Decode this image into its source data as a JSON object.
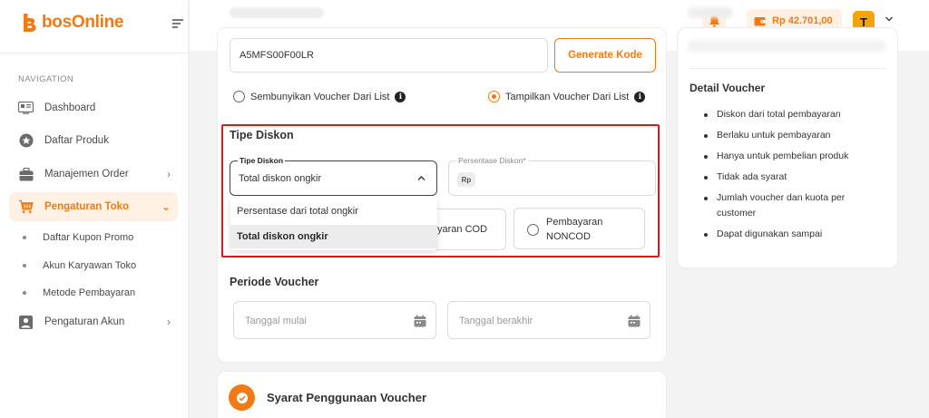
{
  "brand": {
    "name": "bosOnline",
    "accent": "#f07a16"
  },
  "sidebar": {
    "section_title": "NAVIGATION",
    "items": [
      {
        "label": "Dashboard",
        "icon": "dashboard-icon"
      },
      {
        "label": "Daftar Produk",
        "icon": "star-badge-icon"
      },
      {
        "label": "Manajemen Order",
        "icon": "briefcase-icon"
      },
      {
        "label": "Pengaturan Toko",
        "icon": "cart-icon",
        "active": true
      },
      {
        "label": "Pengaturan Akun",
        "icon": "user-icon"
      }
    ],
    "sub_items": [
      "Daftar Kupon Promo",
      "Akun Karyawan Toko",
      "Metode Pembayaran"
    ]
  },
  "topbar": {
    "balance": "Rp 42.701,00",
    "avatar_initial": "T"
  },
  "form": {
    "voucher_code": "A5MFS00F00LR",
    "generate_label": "Generate Kode",
    "visibility": {
      "hide_label": "Sembunyikan Voucher Dari List",
      "show_label": "Tampilkan Voucher Dari List",
      "selected": "show"
    },
    "discount": {
      "section_title": "Tipe Diskon",
      "type_field_label": "Tipe Diskon",
      "type_value": "Total diskon ongkir",
      "percent_field_label": "Persentase Diskon*",
      "currency_prefix": "Rp",
      "options": [
        "Persentase dari total ongkir",
        "Total diskon ongkir"
      ],
      "selected_option": "Total diskon ongkir"
    },
    "payment": {
      "cod_label": "yaran COD",
      "noncod_label_line1": "Pembayaran",
      "noncod_label_line2": "NONCOD"
    },
    "period": {
      "section_title": "Periode Voucher",
      "start_placeholder": "Tanggal mulai",
      "end_placeholder": "Tanggal berakhir"
    },
    "terms_title": "Syarat Penggunaan Voucher"
  },
  "detail": {
    "title": "Detail Voucher",
    "items": [
      "Diskon dari total pembayaran",
      "Berlaku untuk pembayaran",
      "Hanya untuk pembelian produk",
      "Tidak ada syarat",
      "Jumlah voucher dan kuota per customer",
      "Dapat digunakan sampai"
    ]
  }
}
